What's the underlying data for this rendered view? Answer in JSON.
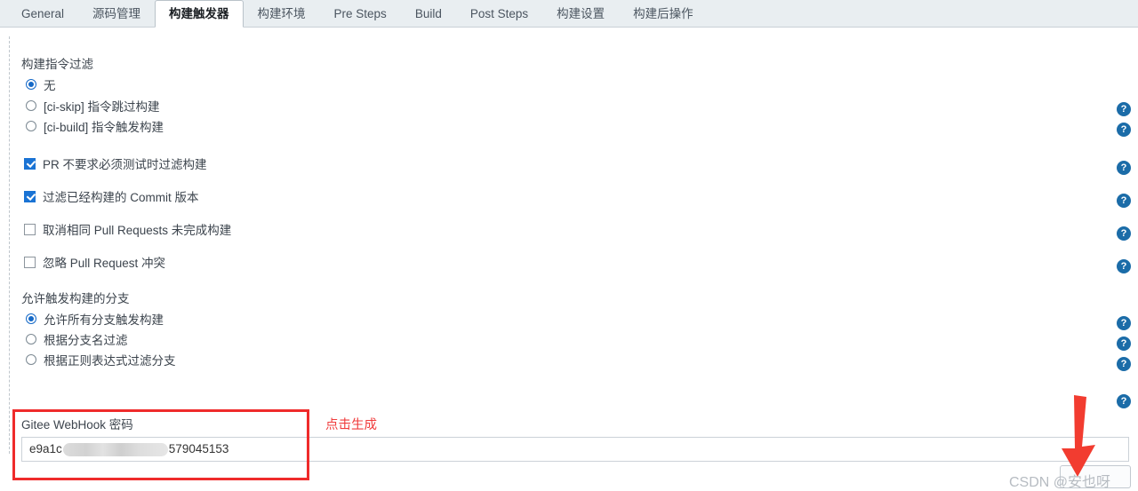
{
  "tabs": [
    {
      "label": "General",
      "active": false
    },
    {
      "label": "源码管理",
      "active": false
    },
    {
      "label": "构建触发器",
      "active": true
    },
    {
      "label": "构建环境",
      "active": false
    },
    {
      "label": "Pre Steps",
      "active": false
    },
    {
      "label": "Build",
      "active": false
    },
    {
      "label": "Post Steps",
      "active": false
    },
    {
      "label": "构建设置",
      "active": false
    },
    {
      "label": "构建后操作",
      "active": false
    }
  ],
  "sections": {
    "command_filter": {
      "title": "构建指令过滤",
      "options": [
        {
          "label": "无",
          "checked": true
        },
        {
          "label": "[ci-skip] 指令跳过构建",
          "checked": false
        },
        {
          "label": "[ci-build] 指令触发构建",
          "checked": false
        }
      ]
    },
    "checkboxes": [
      {
        "label": "PR 不要求必须测试时过滤构建",
        "checked": true
      },
      {
        "label": "过滤已经构建的 Commit 版本",
        "checked": true
      },
      {
        "label": "取消相同 Pull Requests 未完成构建",
        "checked": false
      },
      {
        "label": "忽略 Pull Request 冲突",
        "checked": false
      }
    ],
    "branch_filter": {
      "title": "允许触发构建的分支",
      "options": [
        {
          "label": "允许所有分支触发构建",
          "checked": true
        },
        {
          "label": "根据分支名过滤",
          "checked": false
        },
        {
          "label": "根据正则表达式过滤分支",
          "checked": false
        }
      ]
    }
  },
  "webhook": {
    "label": "Gitee WebHook 密码",
    "value_prefix": "e9a1c",
    "value_suffix": "579045153",
    "hint": "点击生成",
    "generate_button_label": ""
  },
  "icons": {
    "help": "?",
    "help_icon_name": "help-icon",
    "arrow_icon_name": "red-down-arrow-icon"
  },
  "help_icon_positions": [
    115,
    138,
    181,
    218,
    255,
    292,
    356,
    379,
    402,
    444
  ],
  "watermark": "CSDN @安也呀",
  "colors": {
    "accent": "#1569c7",
    "checkbox": "#1a73d4",
    "help": "#1b6ca8",
    "highlight": "#ef2b2b",
    "hint": "#f03c3c",
    "tabbar_bg": "#e9eef1"
  }
}
